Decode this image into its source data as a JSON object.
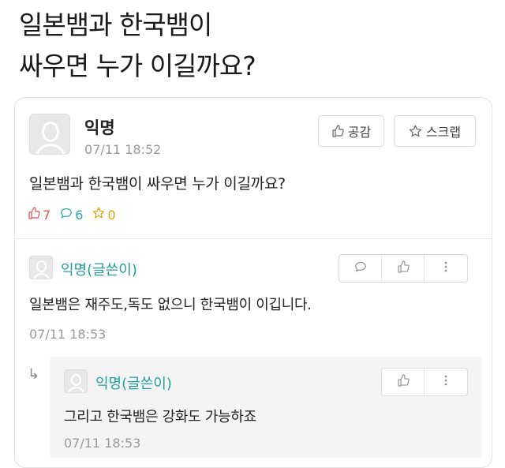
{
  "headline": {
    "line1": "일본뱀과 한국뱀이",
    "line2": "싸우면 누가 이길까요?"
  },
  "post": {
    "author": "익명",
    "time": "07/11 18:52",
    "like_button": "공감",
    "scrap_button": "스크랩",
    "body": "일본뱀과 한국뱀이 싸우면 누가 이길까요?",
    "stats": {
      "likes": "7",
      "comments": "6",
      "scraps": "0"
    }
  },
  "comment": {
    "author": "익명(글쓴이)",
    "body": "일본뱀은 재주도,독도 없으니 한국뱀이 이깁니다.",
    "time": "07/11 18:53"
  },
  "reply": {
    "author": "익명(글쓴이)",
    "body": "그리고 한국뱀은 강화도 가능하죠",
    "time": "07/11 18:53"
  },
  "colors": {
    "like": "#d9534f",
    "comment": "#2aa6a6",
    "scrap": "#e0a400",
    "author_teal": "#1fa09a"
  },
  "icons": [
    "thumb-up-icon",
    "star-icon",
    "speech-bubble-icon",
    "more-vertical-icon",
    "reply-arrow-icon",
    "anonymous-avatar-icon"
  ]
}
